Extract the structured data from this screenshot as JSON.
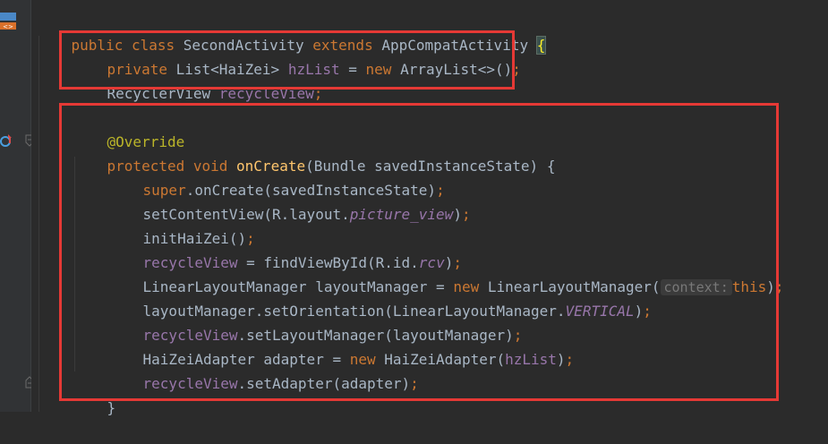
{
  "code": {
    "l1": {
      "t1": "public class ",
      "t2": "SecondActivity ",
      "t3": "extends ",
      "t4": "AppCompatActivity ",
      "t5": "{"
    },
    "l2": {
      "t1": "private ",
      "t2": "List<HaiZei> ",
      "t3": "hzList",
      "t4": " = ",
      "t5": "new ",
      "t6": "ArrayList<>()",
      "t7": ";"
    },
    "l3": {
      "t1": "RecyclerView ",
      "t2": "recycleView",
      "t3": ";"
    },
    "l5": {
      "t1": "@Override"
    },
    "l6": {
      "t1": "protected void ",
      "t2": "onCreate",
      "t3": "(Bundle savedInstanceState) {"
    },
    "l7": {
      "t1": "super",
      "t2": ".onCreate(savedInstanceState)",
      "t3": ";"
    },
    "l8": {
      "t1": "setContentView(R.layout.",
      "t2": "picture_view",
      "t3": ")",
      "t4": ";"
    },
    "l9": {
      "t1": "initHaiZei()",
      "t2": ";"
    },
    "l10": {
      "t1": "recycleView",
      "t2": " = findViewById(R.id.",
      "t3": "rcv",
      "t4": ")",
      "t5": ";"
    },
    "l11": {
      "t1": "LinearLayoutManager layoutManager = ",
      "t2": "new ",
      "t3": "LinearLayoutManager(",
      "t4": "context:",
      "t5": "this",
      "t6": ")",
      "t7": ";"
    },
    "l12": {
      "t1": "layoutManager.setOrientation(LinearLayoutManager.",
      "t2": "VERTICAL",
      "t3": ")",
      "t4": ";"
    },
    "l13": {
      "t1": "recycleView",
      "t2": ".setLayoutManager(layoutManager)",
      "t3": ";"
    },
    "l14": {
      "t1": "HaiZeiAdapter adapter = ",
      "t2": "new ",
      "t3": "HaiZeiAdapter(",
      "t4": "hzList",
      "t5": ")",
      "t6": ";"
    },
    "l15": {
      "t1": "recycleView",
      "t2": ".setAdapter(adapter)",
      "t3": ";"
    },
    "l16": {
      "t1": "}"
    }
  },
  "colors": {
    "keyword": "#cc7832",
    "field": "#9876aa",
    "annotation": "#bbb529",
    "method": "#ffc66d",
    "text": "#a9b7c6",
    "background": "#2b2b2b",
    "highlight_box": "#e53935"
  },
  "icons": [
    "class-file-icon",
    "override-method-icon",
    "fold-marker-icon"
  ]
}
